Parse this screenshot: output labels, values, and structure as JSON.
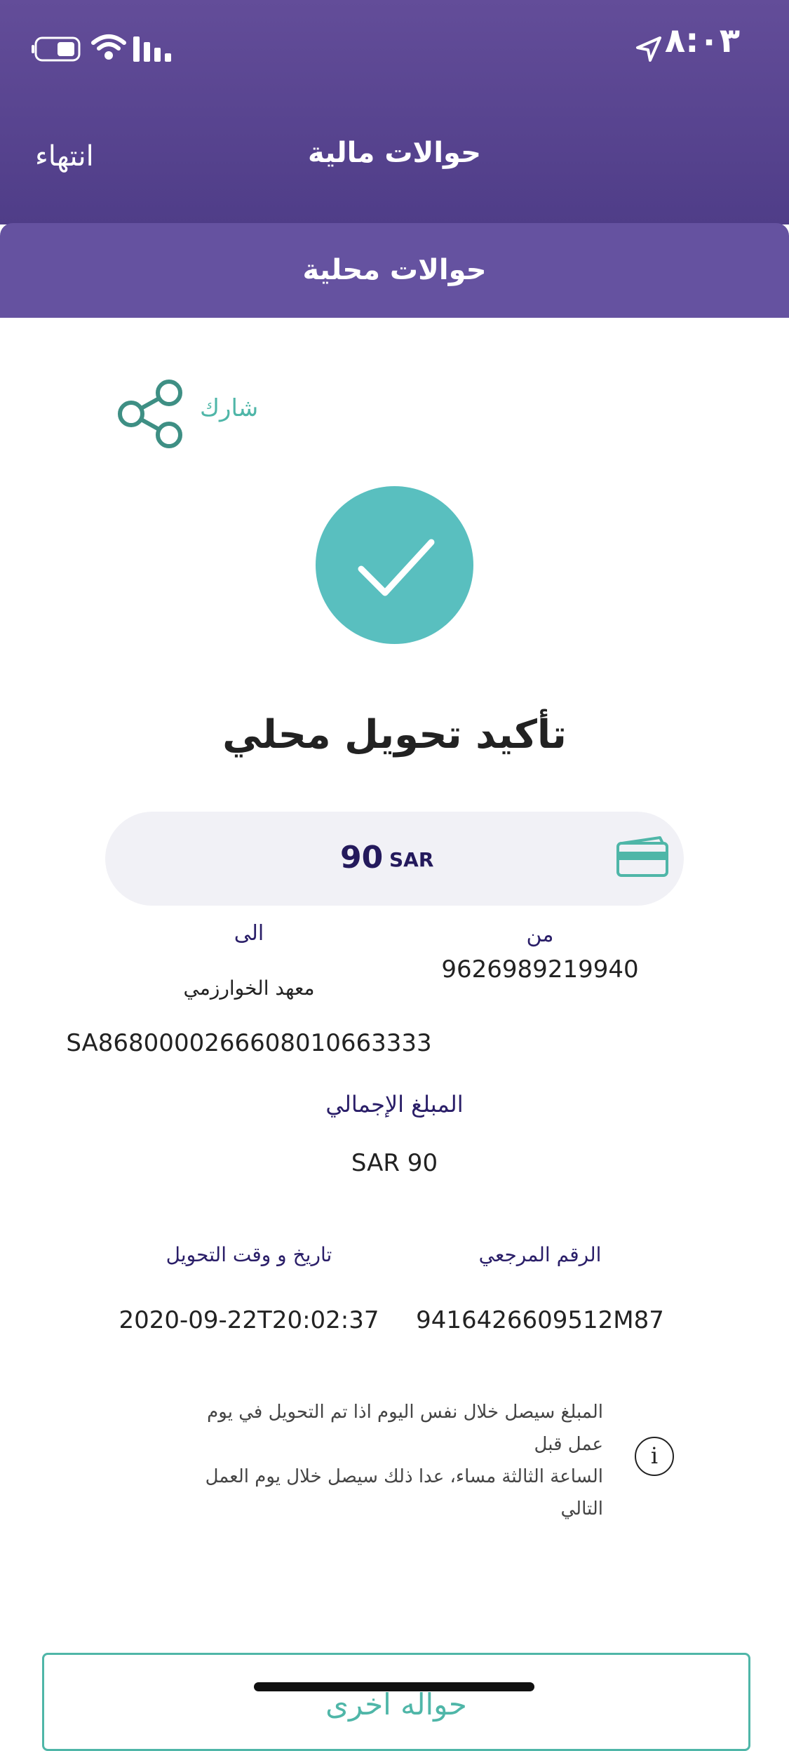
{
  "status_bar": {
    "time": "٨:٠٣"
  },
  "nav": {
    "title": "حوالات مالية",
    "done_label": "انتهاء"
  },
  "subheader": {
    "title": "حوالات محلية"
  },
  "share": {
    "label": "شارك"
  },
  "confirmation": {
    "title": "تأكيد تحويل محلي",
    "amount_value": "90",
    "amount_currency": "SAR"
  },
  "details": {
    "from_label": "من",
    "from_value": "9626989219940",
    "to_label": "الى",
    "to_name": "معهد الخوارزمي",
    "to_iban": "SA8680000266608010663333",
    "total_label": "المبلغ الإجمالي",
    "total_value": "SAR 90",
    "reference_label": "الرقم المرجعي",
    "reference_value": "9416426609512M87",
    "datetime_label": "تاريخ و وقت التحويل",
    "datetime_value": "2020-09-22T20:02:37"
  },
  "note": {
    "line1": "المبلغ سيصل خلال نفس اليوم اذا تم التحويل في يوم عمل قبل",
    "line2": "الساعة الثالثة مساء، عدا ذلك سيصل خلال يوم العمل التالي",
    "info_glyph": "i"
  },
  "actions": {
    "another_transfer_label": "حواله اخرى"
  },
  "colors": {
    "header": "#5a4693",
    "accent": "#4fb6a8",
    "success": "#59bfbf",
    "amount_text": "#241a5c"
  }
}
